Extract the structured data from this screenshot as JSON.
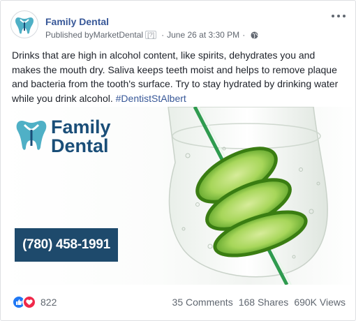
{
  "post": {
    "page_name": "Family Dental",
    "published_by_prefix": "Published by ",
    "publisher": "MarketDental",
    "publisher_help": "[?]",
    "separator": "·",
    "timestamp": "June 26 at 3:30 PM",
    "privacy_icon": "globe-icon",
    "text": "Drinks that are high in alcohol content, like spirits, dehydrates you and makes the mouth dry. Saliva keeps teeth moist and helps to remove plaque and bacteria from the tooth's surface. Try to stay hydrated by drinking water while you drink alcohol. ",
    "hashtag": "#DentistStAlbert"
  },
  "image": {
    "brand_line1": "Family",
    "brand_line2": "Dental",
    "phone": "(780) 458-1991",
    "colors": {
      "brand": "#1a4e78",
      "phone_bg": "#1e4a6c",
      "lime": "#4f9a1c"
    }
  },
  "footer": {
    "reaction_icons": [
      "like-icon",
      "love-icon"
    ],
    "reaction_count": "822",
    "comments": "35 Comments",
    "shares": "168 Shares",
    "views": "690K Views"
  },
  "colors": {
    "link": "#385898",
    "muted": "#616770"
  }
}
